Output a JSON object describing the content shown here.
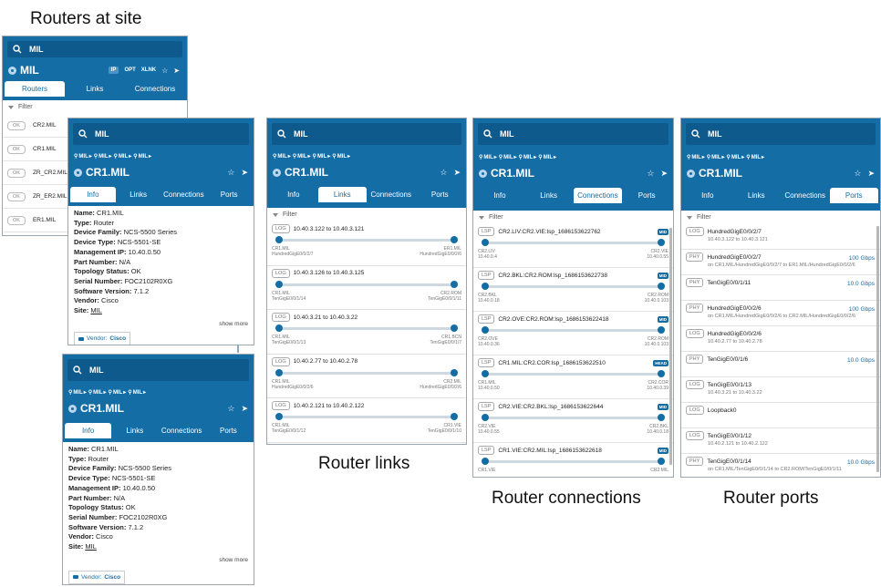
{
  "captions": {
    "routers_at_site": "Routers at site",
    "router_links": "Router links",
    "router_connections": "Router connections",
    "router_ports": "Router ports"
  },
  "search_value": "MIL",
  "breadcrumb": [
    "MIL",
    "MIL",
    "MIL",
    "MIL"
  ],
  "router_title": "CR1.MIL",
  "site_panel": {
    "title": "MIL",
    "layer_buttons": [
      "IP",
      "OPT",
      "XLNK"
    ],
    "tabs": [
      "Routers",
      "Links",
      "Connections"
    ],
    "filter_label": "Filter",
    "ok_label": "OK",
    "routers": [
      "CR2.MIL",
      "CR1.MIL",
      "ZR_CR2.MIL",
      "ZR_ER2.MIL",
      "ER1.MIL"
    ]
  },
  "router_tabs": [
    "Info",
    "Links",
    "Connections",
    "Ports"
  ],
  "filter_label": "Filter",
  "info": {
    "name_label": "Name:",
    "name": "CR1.MIL",
    "type_label": "Type:",
    "type": "Router",
    "family_label": "Device Family:",
    "family": "NCS-5500 Series",
    "dtype_label": "Device Type:",
    "dtype": "NCS-5501-SE",
    "mgmt_label": "Management IP:",
    "mgmt": "10.40.0.50",
    "part_label": "Part Number:",
    "part": "N/A",
    "topo_label": "Topology Status:",
    "topo": "OK",
    "serial_label": "Serial Number:",
    "serial": "FOC2102R0XG",
    "sw_label": "Software Version:",
    "sw": "7.1.2",
    "vendor_label": "Vendor:",
    "vendor": "Cisco",
    "site_label": "Site:",
    "site": "MIL",
    "show_more": "show more",
    "vendor_chip_label": "Vendor:",
    "vendor_chip_value": "Cisco"
  },
  "links": [
    {
      "badge": "LOG",
      "name": "10.40.3.122 to 10.40.3.121",
      "a": "CR1.MIL",
      "a_port": "HundredGigE0/0/2/7",
      "b": "ER1.MIL",
      "b_port": "HundredGigE0/0/2/6"
    },
    {
      "badge": "LOG",
      "name": "10.40.3.126 to 10.40.3.125",
      "a": "CR1.MIL",
      "a_port": "TenGigE0/0/1/14",
      "b": "CR2.ROM",
      "b_port": "TenGigE0/0/1/11"
    },
    {
      "badge": "LOG",
      "name": "10.40.3.21 to 10.40.3.22",
      "a": "CR1.MIL",
      "a_port": "TenGigE0/0/1/13",
      "b": "CR1.BCN",
      "b_port": "TenGigE0/0/1/7"
    },
    {
      "badge": "LOG",
      "name": "10.40.2.77 to 10.40.2.78",
      "a": "CR1.MIL",
      "a_port": "HundredGigE0/0/2/6",
      "b": "CR2.MIL",
      "b_port": "HundredGigE0/0/2/6"
    },
    {
      "badge": "LOG",
      "name": "10.40.2.121 to 10.40.2.122",
      "a": "CR1.MIL",
      "a_port": "TenGigE0/0/1/12",
      "b": "CR1.VIE",
      "b_port": "TenGigE0/0/1/10"
    }
  ],
  "connections": [
    {
      "badge": "LSP",
      "name": "CR2.LIV:CR2.VIE:lsp_1686153622762",
      "status": "MID",
      "a": "CR2.LIV",
      "a_ip": "10.40.0.4",
      "b": "CR2.VIE",
      "b_ip": "10.40.0.55"
    },
    {
      "badge": "LSP",
      "name": "CR2.BKL:CR2.ROM:lsp_1686153622738",
      "status": "MID",
      "a": "CR2.BKL",
      "a_ip": "10.40.0.18",
      "b": "CR2.ROM",
      "b_ip": "10.40.0.103"
    },
    {
      "badge": "LSP",
      "name": "CR2.OVE:CR2.ROM:lsp_1686153622418",
      "status": "MID",
      "a": "CR2.OVE",
      "a_ip": "10.40.0.36",
      "b": "CR2.ROM",
      "b_ip": "10.40.0.103"
    },
    {
      "badge": "LSP",
      "name": "CR1.MIL:CR2.COR:lsp_1686153622510",
      "status": "HEAD",
      "a": "CR1.MIL",
      "a_ip": "10.40.0.50",
      "b": "CR2.COR",
      "b_ip": "10.40.0.39"
    },
    {
      "badge": "LSP",
      "name": "CR2.VIE:CR2.BKL:lsp_1686153622644",
      "status": "MID",
      "a": "CR2.VIE",
      "a_ip": "10.40.0.55",
      "b": "CR2.BKL",
      "b_ip": "10.40.0.18"
    },
    {
      "badge": "LSP",
      "name": "CR1.VIE:CR2.MIL:lsp_1686153622618",
      "status": "MID",
      "a": "CR1.VIE",
      "a_ip": "",
      "b": "CR2.MIL",
      "b_ip": ""
    }
  ],
  "ports": [
    {
      "badge": "LOG",
      "name": "HundredGigE0/0/2/7",
      "sub": "10.40.3.122 to 10.40.3.121",
      "speed": ""
    },
    {
      "badge": "PHY",
      "name": "HundredGigE0/0/2/7",
      "sub": "on CR1.MIL/HundredGigE0/0/2/7 to ER1.MIL/HundredGigE0/0/2/6",
      "speed": "100 Gbps"
    },
    {
      "badge": "PHY",
      "name": "TenGigE0/0/1/11",
      "sub": "",
      "speed": "10.0 Gbps"
    },
    {
      "badge": "PHY",
      "name": "HundredGigE0/0/2/6",
      "sub": "on CR1.MIL/HundredGigE0/0/2/6 to CR2.MIL/HundredGigE0/0/2/6",
      "speed": "100 Gbps"
    },
    {
      "badge": "LOG",
      "name": "HundredGigE0/0/2/6",
      "sub": "10.40.2.77 to 10.40.2.78",
      "speed": ""
    },
    {
      "badge": "PHY",
      "name": "TenGigE0/0/1/6",
      "sub": "",
      "speed": "10.0 Gbps"
    },
    {
      "badge": "LOG",
      "name": "TenGigE0/0/1/13",
      "sub": "10.40.3.21 to 10.40.3.22",
      "speed": ""
    },
    {
      "badge": "LOG",
      "name": "Loopback0",
      "sub": "",
      "speed": ""
    },
    {
      "badge": "LOG",
      "name": "TenGigE0/0/1/12",
      "sub": "10.40.2.121 to 10.40.2.122",
      "speed": ""
    },
    {
      "badge": "PHY",
      "name": "TenGigE0/0/1/14",
      "sub": "on CR1.MIL/TenGigE0/0/1/14 to CR2.ROM/TenGigE0/0/1/11",
      "speed": "10.0 Gbps"
    }
  ],
  "colors": {
    "header": "#156da6",
    "search": "#0f5a8c",
    "accent": "#156da6"
  }
}
